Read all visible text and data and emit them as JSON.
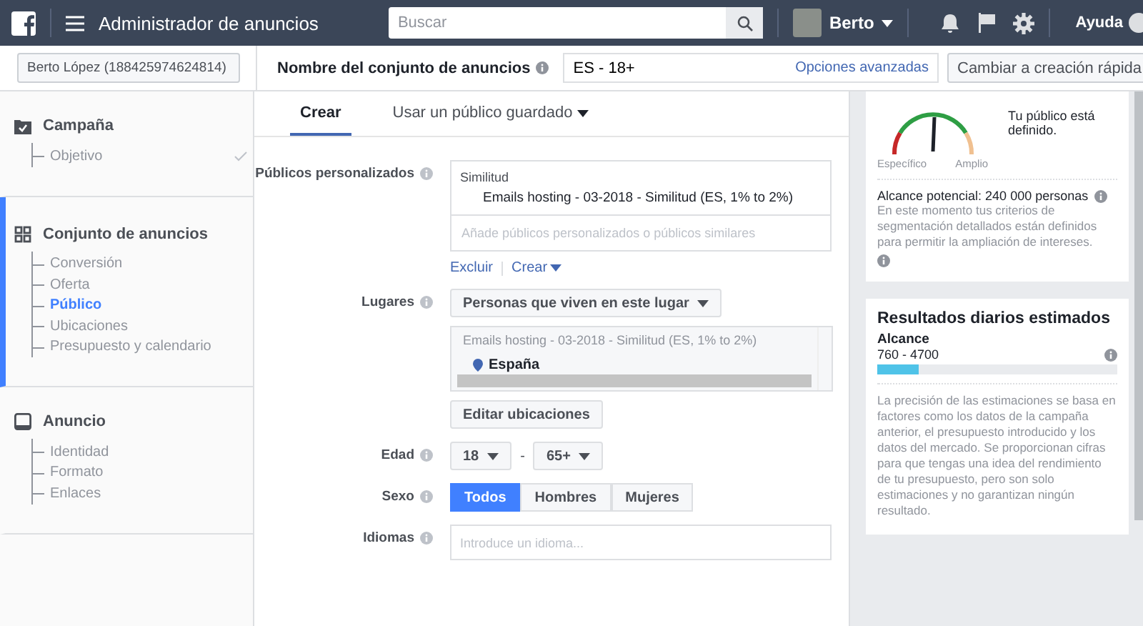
{
  "top_bar": {
    "title": "Administrador de anuncios",
    "search": {
      "placeholder": "Buscar"
    },
    "user": "Berto",
    "help": "Ayuda"
  },
  "sub_bar": {
    "account": "Berto López (188425974624814)",
    "name_label": "Nombre del conjunto de anuncios",
    "name_value": "ES - 18+",
    "advanced": "Opciones avanzadas",
    "quick_button": "Cambiar a creación rápida"
  },
  "sidebar": {
    "sections": [
      {
        "title": "Campaña",
        "kind": "campaign",
        "active": false,
        "items": [
          {
            "label": "Objetivo",
            "selected": false,
            "completed": true
          }
        ]
      },
      {
        "title": "Conjunto de anuncios",
        "kind": "adset",
        "active": true,
        "items": [
          {
            "label": "Conversión",
            "selected": false,
            "completed": false
          },
          {
            "label": "Oferta",
            "selected": false,
            "completed": false
          },
          {
            "label": "Público",
            "selected": true,
            "completed": false
          },
          {
            "label": "Ubicaciones",
            "selected": false,
            "completed": false
          },
          {
            "label": "Presupuesto y calendario",
            "selected": false,
            "completed": false
          }
        ]
      },
      {
        "title": "Anuncio",
        "kind": "ad",
        "active": false,
        "items": [
          {
            "label": "Identidad",
            "selected": false,
            "completed": false
          },
          {
            "label": "Formato",
            "selected": false,
            "completed": false
          },
          {
            "label": "Enlaces",
            "selected": false,
            "completed": false
          }
        ]
      }
    ]
  },
  "tabs": [
    {
      "label": "Crear",
      "selected": true,
      "dropdown": false
    },
    {
      "label": "Usar un público guardado",
      "selected": false,
      "dropdown": true
    }
  ],
  "form": {
    "custom_audiences": {
      "label": "Públicos personalizados",
      "group": "Similitud",
      "audience": "Emails hosting - 03-2018 - Similitud (ES, 1% to 2%)",
      "placeholder": "Añade públicos personalizados o públicos similares",
      "exclude": "Excluir",
      "create": "Crear"
    },
    "locations": {
      "label": "Lugares",
      "type": "Personas que viven en este lugar",
      "audience": "Emails hosting - 03-2018 - Similitud (ES, 1% to 2%)",
      "place": "España",
      "edit": "Editar ubicaciones"
    },
    "age": {
      "label": "Edad",
      "min": "18",
      "separator": "-",
      "max": "65+"
    },
    "gender": {
      "label": "Sexo",
      "options": [
        {
          "label": "Todos",
          "selected": true
        },
        {
          "label": "Hombres",
          "selected": false
        },
        {
          "label": "Mujeres",
          "selected": false
        }
      ]
    },
    "languages": {
      "label": "Idiomas",
      "placeholder": "Introduce un idioma..."
    }
  },
  "audience_size": {
    "min_label": "Específico",
    "max_label": "Amplio",
    "status": "Tu público está definido.",
    "reach": "Alcance potencial: 240 000 personas",
    "note": "En este momento tus criterios de segmentación detallados están definidos para permitir la ampliación de intereses."
  },
  "daily_results": {
    "title": "Resultados diarios estimados",
    "metric": "Alcance",
    "range": "760 - 4700",
    "level": 0.17,
    "note": "La precisión de las estimaciones se basa en factores como los datos de la campaña anterior, el presupuesto introducido y los datos del mercado. Se proporcionan cifras para que tengas una idea del rendimiento de tu presupuesto, pero son solo estimaciones y no garantizan ningún resultado."
  }
}
